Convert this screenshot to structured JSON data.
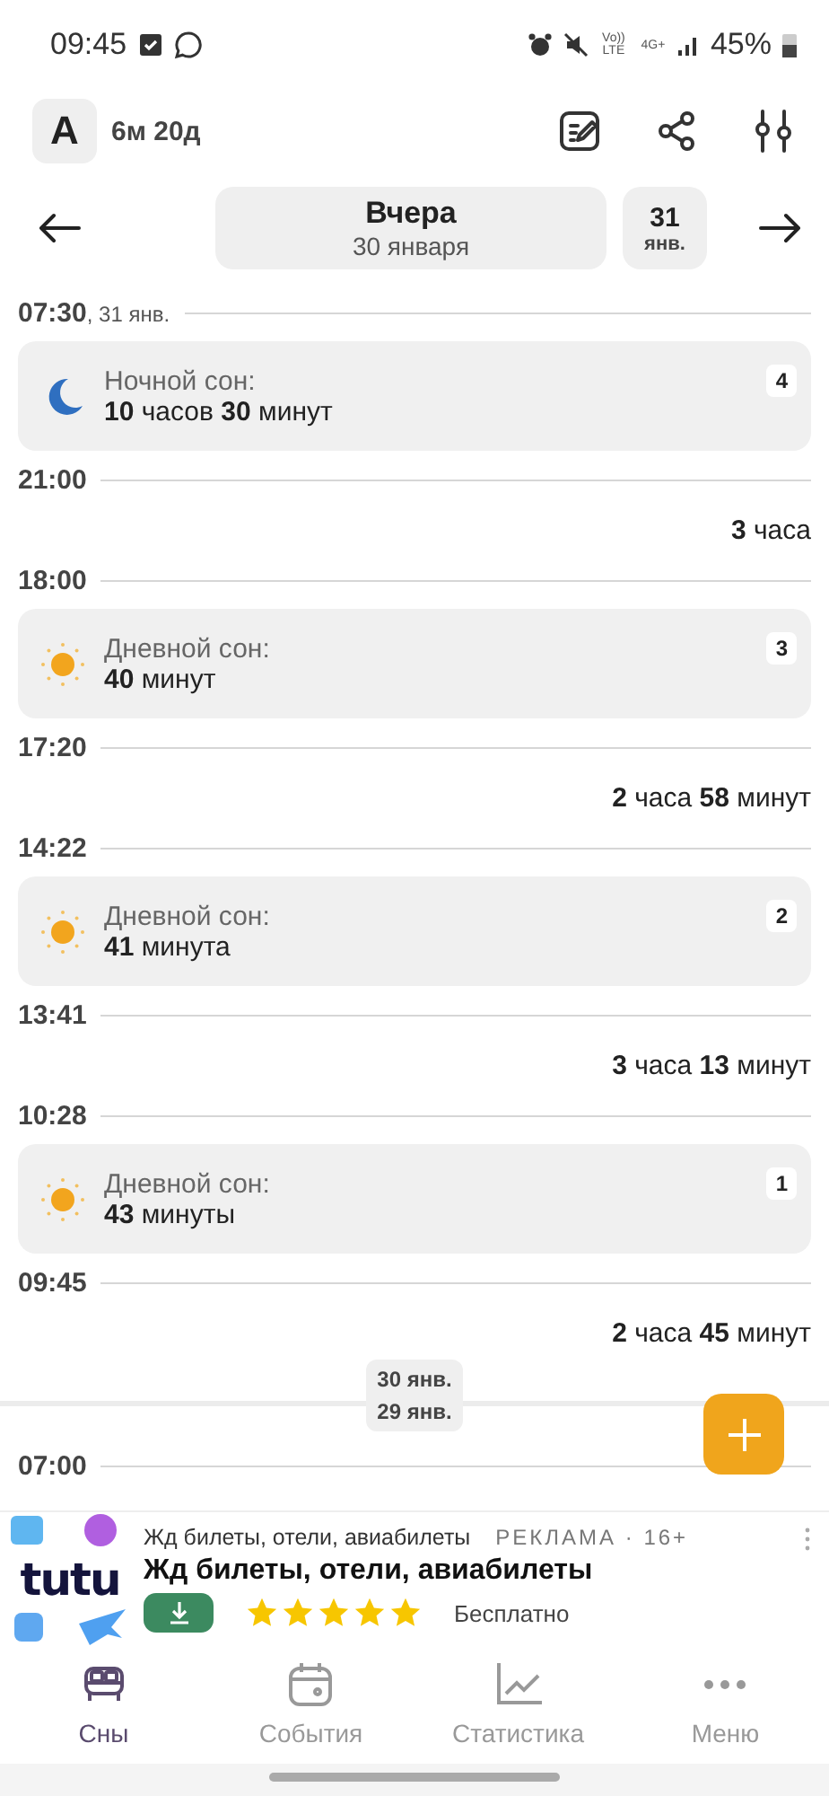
{
  "status_bar": {
    "time": "09:45",
    "network_labels": [
      "Vo)) LTE",
      "4G+"
    ],
    "battery": "45%"
  },
  "header": {
    "avatar": "A",
    "age": "6м 20д"
  },
  "date_nav": {
    "title": "Вчера",
    "date": "30 января",
    "next_day": "31",
    "next_month": "янв."
  },
  "timeline": [
    {
      "kind": "time",
      "time": "07:30",
      "date": ", 31 янв."
    },
    {
      "kind": "sleep",
      "night": true,
      "label": "Ночной сон:",
      "duration": "**10** часов **30** минут",
      "number": "4"
    },
    {
      "kind": "time",
      "time": "21:00"
    },
    {
      "kind": "gap",
      "duration": "**3** часа"
    },
    {
      "kind": "time",
      "time": "18:00"
    },
    {
      "kind": "sleep",
      "night": false,
      "label": "Дневной сон:",
      "duration": "**40** минут",
      "number": "3"
    },
    {
      "kind": "time",
      "time": "17:20"
    },
    {
      "kind": "gap",
      "duration": "**2** часа **58** минут"
    },
    {
      "kind": "time",
      "time": "14:22"
    },
    {
      "kind": "sleep",
      "night": false,
      "label": "Дневной сон:",
      "duration": "**41** минута",
      "number": "2"
    },
    {
      "kind": "time",
      "time": "13:41"
    },
    {
      "kind": "gap",
      "duration": "**3** часа **13** минут"
    },
    {
      "kind": "time",
      "time": "10:28"
    },
    {
      "kind": "sleep",
      "night": false,
      "label": "Дневной сон:",
      "duration": "**43** минуты",
      "number": "1"
    },
    {
      "kind": "time",
      "time": "09:45"
    },
    {
      "kind": "gap",
      "duration": "**2** часа **45** минут"
    },
    {
      "kind": "day_break",
      "upper": "30 янв.",
      "lower": "29 янв."
    },
    {
      "kind": "time",
      "time": "07:00"
    }
  ],
  "ad": {
    "logo": "tutu",
    "subtitle": "Жд билеты, отели, авиабилеты",
    "tag": "РЕКЛАМА · 16+",
    "title": "Жд билеты, отели, авиабилеты",
    "stars": 5,
    "price": "Бесплатно"
  },
  "nav": [
    {
      "label": "Сны",
      "selected": true
    },
    {
      "label": "События",
      "selected": false
    },
    {
      "label": "Статистика",
      "selected": false
    },
    {
      "label": "Меню",
      "selected": false
    }
  ]
}
